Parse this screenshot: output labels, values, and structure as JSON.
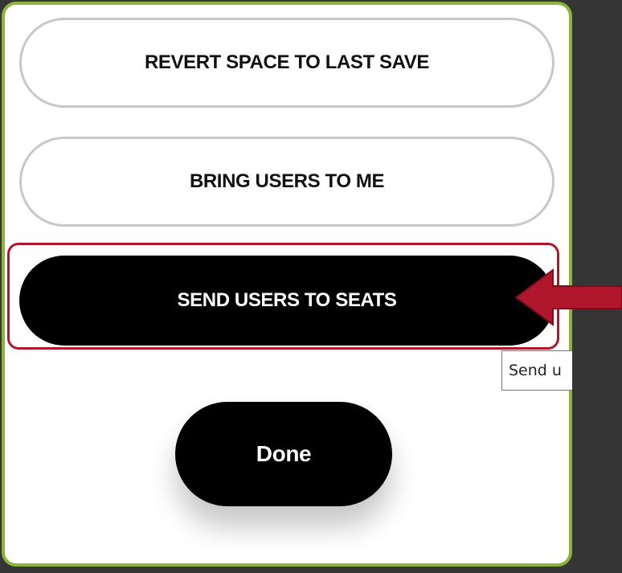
{
  "dialog": {
    "buttons": {
      "revert": "REVERT SPACE TO LAST SAVE",
      "bring": "BRING USERS TO ME",
      "send": "SEND USERS TO SEATS",
      "done": "Done"
    },
    "tooltip": "Send u"
  },
  "annotation": {
    "highlight_color": "#b0162c",
    "arrow_icon": "left-arrow-icon"
  },
  "colors": {
    "panel_border": "#8cb33c",
    "background": "#353535",
    "primary_button": "#000000"
  }
}
